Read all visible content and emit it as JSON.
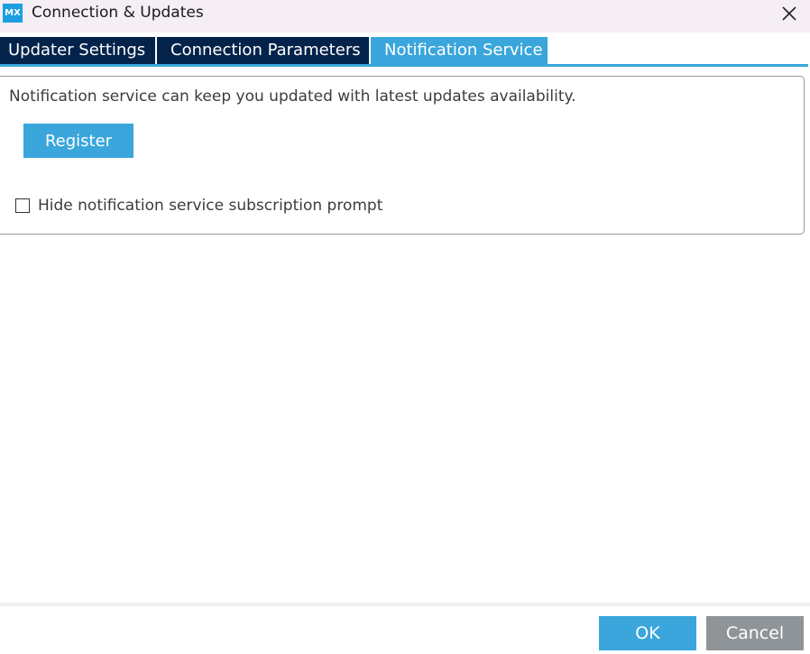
{
  "window": {
    "logo_text": "MX",
    "title": "Connection & Updates"
  },
  "tabs": [
    {
      "label": "Updater Settings",
      "active": false
    },
    {
      "label": "Connection Parameters",
      "active": false
    },
    {
      "label": "Notification Service",
      "active": true
    }
  ],
  "notification": {
    "description": "Notification service can keep you updated with latest updates availability.",
    "register_label": "Register",
    "hide_prompt_label": "Hide notification service subscription prompt",
    "hide_prompt_checked": false
  },
  "footer": {
    "ok_label": "OK",
    "cancel_label": "Cancel"
  },
  "colors": {
    "accent": "#3aa6dc",
    "tab_dark": "#03234b",
    "cancel_gray": "#8f9499",
    "titlebar": "#f6eef5"
  }
}
